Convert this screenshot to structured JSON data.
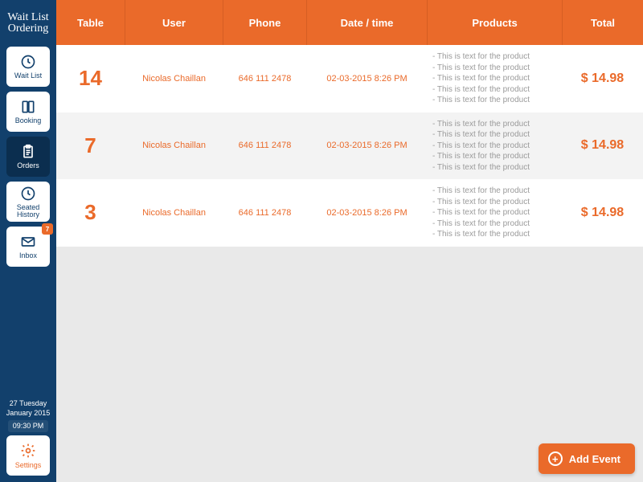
{
  "brand": "Wait List Ordering",
  "sidebar": {
    "items": [
      {
        "key": "waitlist",
        "label": "Wait List"
      },
      {
        "key": "booking",
        "label": "Booking"
      },
      {
        "key": "orders",
        "label": "Orders"
      },
      {
        "key": "seated",
        "label": "Seated\nHistory"
      },
      {
        "key": "inbox",
        "label": "Inbox",
        "badge": "7"
      }
    ],
    "active": "orders",
    "date_top": "27 Tuesday",
    "date_bottom": "January 2015",
    "time": "09:30 PM",
    "settings_label": "Settings"
  },
  "columns": {
    "table": "Table",
    "user": "User",
    "phone": "Phone",
    "datetime": "Date / time",
    "products": "Products",
    "total": "Total"
  },
  "rows": [
    {
      "table": "14",
      "user": "Nicolas Chaillan",
      "phone": "646 111 2478",
      "datetime": "02-03-2015 8:26 PM",
      "products": [
        "- This is text for the product",
        "- This is text for the product",
        "- This is text for the product",
        "- This is text for the product",
        "- This is text for the product"
      ],
      "total": "$ 14.98"
    },
    {
      "table": "7",
      "user": "Nicolas Chaillan",
      "phone": "646 111 2478",
      "datetime": "02-03-2015 8:26 PM",
      "products": [
        "- This is text for the product",
        "- This is text for the product",
        "- This is text for the product",
        "- This is text for the product",
        "- This is text for the product"
      ],
      "total": "$ 14.98"
    },
    {
      "table": "3",
      "user": "Nicolas Chaillan",
      "phone": "646 111 2478",
      "datetime": "02-03-2015 8:26 PM",
      "products": [
        "- This is text for the product",
        "- This is text for the product",
        "- This is text for the product",
        "- This is text for the product",
        "- This is text for the product"
      ],
      "total": "$ 14.98"
    }
  ],
  "add_event_label": "Add Event"
}
